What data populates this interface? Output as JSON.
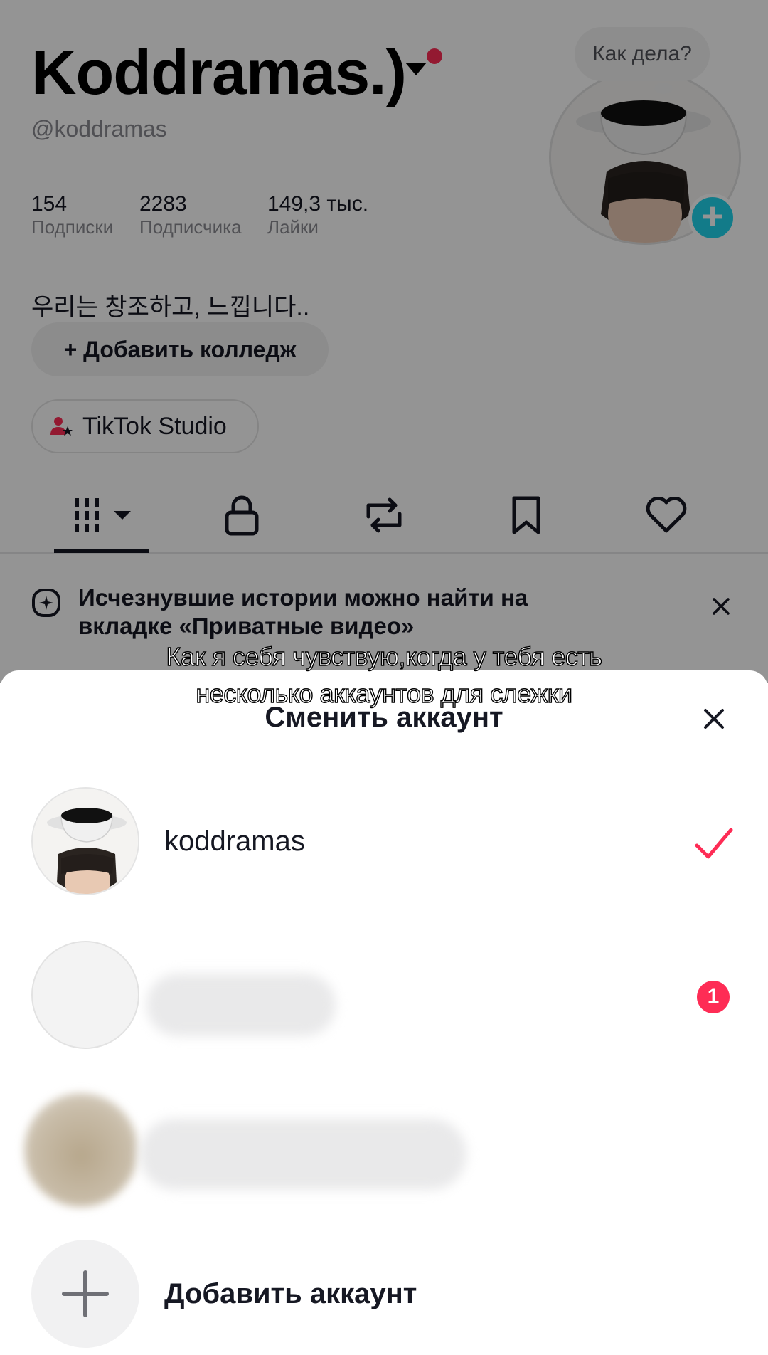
{
  "profile": {
    "display_name": "Koddramas.)",
    "handle": "@koddramas",
    "bubble_text": "Как дела?",
    "stats": [
      {
        "value": "154",
        "label": "Подписки"
      },
      {
        "value": "2283",
        "label": "Подписчика"
      },
      {
        "value": "149,3 тыс.",
        "label": "Лайки"
      }
    ],
    "bio": "우리는 창조하고, 느낍니다..",
    "add_college_label": "+ Добавить колледж",
    "studio_label": "TikTok Studio",
    "banner_line1": "Исчезнувшие истории можно найти на",
    "banner_line2": "вкладке «Приватные видео»"
  },
  "caption": {
    "line1": "Как я себя чувствую,когда у тебя есть",
    "line2": "несколько аккаунтов для слежки"
  },
  "sheet": {
    "title": "Сменить аккаунт",
    "accounts": [
      {
        "name": "koddramas",
        "selected": true
      },
      {
        "name": "",
        "notification_count": "1"
      },
      {
        "name": ""
      }
    ],
    "add_account_label": "Добавить аккаунт"
  },
  "colors": {
    "accent": "#fe2c55",
    "badge_blue": "#20d5ec"
  }
}
